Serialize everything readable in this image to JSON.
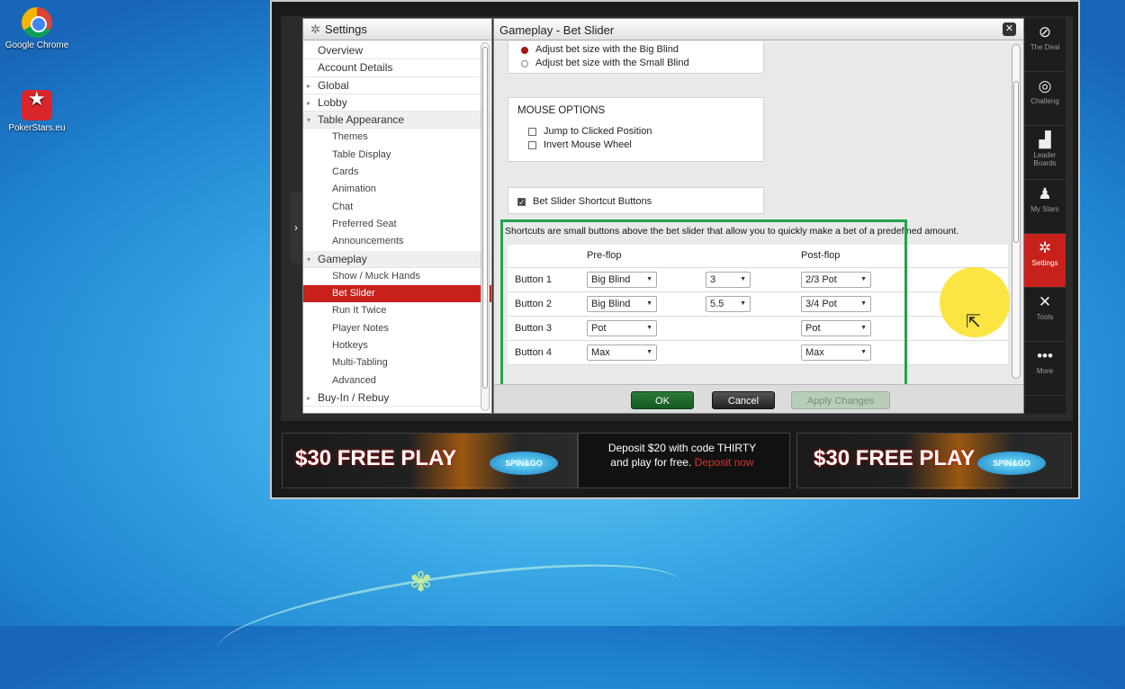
{
  "desktop": {
    "icons": [
      {
        "label": "Google Chrome"
      },
      {
        "label": "PokerStars.eu"
      }
    ]
  },
  "left": {
    "title": "Settings",
    "items": [
      {
        "label": "Overview",
        "level": 0
      },
      {
        "label": "Account Details",
        "level": 0
      },
      {
        "label": "Global",
        "level": 0,
        "arrow": "▸"
      },
      {
        "label": "Lobby",
        "level": 0,
        "arrow": "▸"
      },
      {
        "label": "Table Appearance",
        "level": 0,
        "arrow": "▾"
      },
      {
        "label": "Themes",
        "level": 1
      },
      {
        "label": "Table Display",
        "level": 1
      },
      {
        "label": "Cards",
        "level": 1
      },
      {
        "label": "Animation",
        "level": 1
      },
      {
        "label": "Chat",
        "level": 1
      },
      {
        "label": "Preferred Seat",
        "level": 1
      },
      {
        "label": "Announcements",
        "level": 1
      },
      {
        "label": "Gameplay",
        "level": 0,
        "arrow": "▾"
      },
      {
        "label": "Show / Muck Hands",
        "level": 1
      },
      {
        "label": "Bet Slider",
        "level": 1,
        "selected": true
      },
      {
        "label": "Run It Twice",
        "level": 1
      },
      {
        "label": "Player Notes",
        "level": 1
      },
      {
        "label": "Hotkeys",
        "level": 1
      },
      {
        "label": "Multi-Tabling",
        "level": 1
      },
      {
        "label": "Advanced",
        "level": 1
      },
      {
        "label": "Buy-In / Rebuy",
        "level": 0,
        "arrow": "▸"
      }
    ]
  },
  "right": {
    "title": "Gameplay - Bet Slider",
    "radio_big": "Adjust bet size with the Big Blind",
    "radio_small": "Adjust bet size with the Small Blind",
    "mouse_header": "MOUSE OPTIONS",
    "jump": "Jump to Clicked Position",
    "invert": "Invert Mouse Wheel",
    "shortcut_toggle": "Bet Slider Shortcut Buttons",
    "description": "Shortcuts are small buttons above the bet slider that allow you to quickly make a bet of a predefined amount.",
    "col_pre": "Pre-flop",
    "col_post": "Post-flop",
    "rows": [
      {
        "label": "Button 1",
        "pre": "Big Blind",
        "mult": "3",
        "post": "2/3 Pot"
      },
      {
        "label": "Button 2",
        "pre": "Big Blind",
        "mult": "5.5",
        "post": "3/4 Pot"
      },
      {
        "label": "Button 3",
        "pre": "Pot",
        "mult": "",
        "post": "Pot"
      },
      {
        "label": "Button 4",
        "pre": "Max",
        "mult": "",
        "post": "Max"
      }
    ],
    "ok": "OK",
    "cancel": "Cancel",
    "apply": "Apply Changes"
  },
  "sidebar": [
    {
      "icon": "deal-icon",
      "glyph": "⊘",
      "label": "The Deal"
    },
    {
      "icon": "challenge-icon",
      "glyph": "◎",
      "label": "Challeng"
    },
    {
      "icon": "leaderboard-icon",
      "glyph": "▟",
      "label": "Leader Boards"
    },
    {
      "icon": "star-icon",
      "glyph": "♟",
      "label": "My Stars"
    },
    {
      "icon": "gear-icon",
      "glyph": "✲",
      "label": "Settings",
      "active": true
    },
    {
      "icon": "tools-icon",
      "glyph": "✕",
      "label": "Tools"
    },
    {
      "icon": "more-icon",
      "glyph": "•••",
      "label": "More"
    }
  ],
  "banners": {
    "free": "$30 FREE PLAY",
    "spin": "SPIN&GO",
    "promo_line1": "Deposit $20 with code THIRTY",
    "promo_line2": "and play for free.",
    "promo_link": "Deposit now"
  },
  "colors": {
    "accent": "#c8211c",
    "highlight": "#22a34a"
  }
}
